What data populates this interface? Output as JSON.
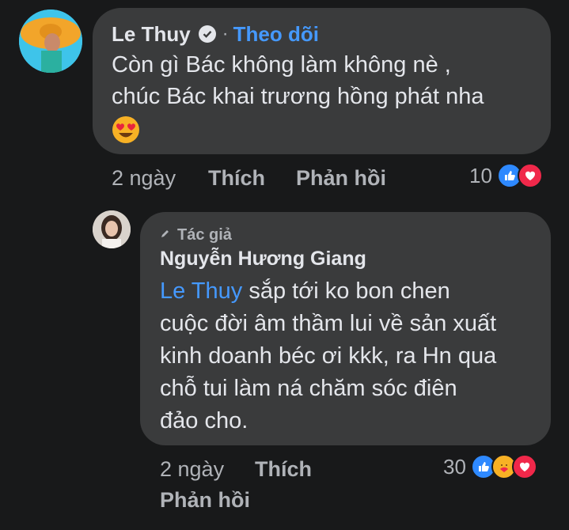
{
  "comment": {
    "author": "Le Thuy",
    "separator": "·",
    "follow_label": "Theo dõi",
    "text_line1": "Còn gì Bác không làm không nè ,",
    "text_line2": "chúc Bác khai trương hồng phát nha",
    "emoji": "heart-eyes-emoji",
    "time": "2 ngày",
    "like_label": "Thích",
    "reply_label": "Phản hồi",
    "reaction_count": "10",
    "reaction_icons": [
      "like-icon",
      "love-icon"
    ]
  },
  "reply": {
    "badge_label": "Tác giả",
    "author": "Nguyễn Hương Giang",
    "mention": "Le Thuy",
    "text_line1_rest": " sắp tới ko bon chen",
    "text_line2": "cuộc đời âm thầm lui về sản xuất",
    "text_line3": "kinh doanh béc ơi kkk, ra Hn qua",
    "text_line4": "chỗ tui làm ná chăm sóc điên",
    "text_line5": "đảo cho.",
    "time": "2 ngày",
    "like_label": "Thích",
    "reply_label": "Phản hồi",
    "reaction_count": "30",
    "reaction_icons": [
      "like-icon",
      "care-icon",
      "love-icon"
    ]
  },
  "colors": {
    "background": "#18191a",
    "bubble": "#3a3b3c",
    "link": "#4599ff",
    "secondary_text": "#b0b3b8"
  }
}
